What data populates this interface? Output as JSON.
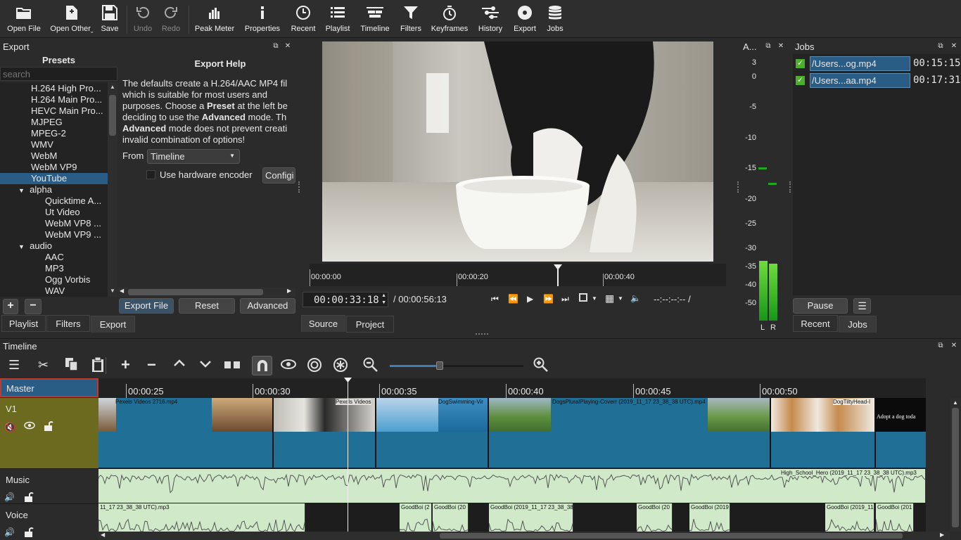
{
  "toolbar": {
    "open_file": "Open File",
    "open_other": "Open Otherˬ",
    "save": "Save",
    "undo": "Undo",
    "redo": "Redo",
    "peak_meter": "Peak Meter",
    "properties": "Properties",
    "recent": "Recent",
    "playlist": "Playlist",
    "timeline": "Timeline",
    "filters": "Filters",
    "keyframes": "Keyframes",
    "history": "History",
    "export": "Export",
    "jobs": "Jobs"
  },
  "export_panel": {
    "title": "Export",
    "presets_label": "Presets",
    "search_placeholder": "search",
    "presets": [
      "H.264 High Pro...",
      "H.264 Main Pro...",
      "HEVC Main Pro...",
      "MJPEG",
      "MPEG-2",
      "WMV",
      "WebM",
      "WebM VP9",
      "YouTube"
    ],
    "group_alpha": "alpha",
    "alpha_items": [
      "Quicktime A...",
      "Ut Video",
      "WebM VP8 ...",
      "WebM VP9 ..."
    ],
    "group_audio": "audio",
    "audio_items": [
      "AAC",
      "MP3",
      "Ogg Vorbis",
      "WAV"
    ],
    "help_title": "Export Help",
    "help_lines": [
      "The defaults create a H.264/AAC MP4 fil",
      "which is suitable for most users and",
      "purposes. Choose a ",
      "Preset",
      " at the left be",
      "deciding to use the ",
      "Advanced",
      " mode. Th",
      "Advanced",
      " mode does not prevent creati",
      "invalid combination of options!"
    ],
    "from_label": "From",
    "from_value": "Timeline",
    "hw_encoder_label": "Use hardware encoder",
    "configure_label": "Configi",
    "export_file_btn": "Export File",
    "reset_btn": "Reset",
    "advanced_btn": "Advanced"
  },
  "left_tabs": {
    "playlist": "Playlist",
    "filters": "Filters",
    "export": "Export"
  },
  "player": {
    "ruler_labels": [
      "00:00:00",
      "00:00:20",
      "00:00:40"
    ],
    "current_time": "00:00:33:18",
    "total_time": "/ 00:00:56:13",
    "in_out": "--:--:--:-- /",
    "source_tab": "Source",
    "project_tab": "Project"
  },
  "audio_meter": {
    "title": "A...",
    "scale": [
      "3",
      "0",
      "-5",
      "-10",
      "-15",
      "-20",
      "-25",
      "-30",
      "-35",
      "-40",
      "-50"
    ],
    "left_label": "L",
    "right_label": "R"
  },
  "jobs_panel": {
    "title": "Jobs",
    "jobs": [
      {
        "name": "/Users...og.mp4",
        "time": "00:15:15"
      },
      {
        "name": "/Users...aa.mp4",
        "time": "00:17:31"
      }
    ],
    "pause_btn": "Pause",
    "recent_tab": "Recent",
    "jobs_tab": "Jobs"
  },
  "timeline": {
    "title": "Timeline",
    "ruler": [
      "00:00:25",
      "00:00:30",
      "00:00:35",
      "00:00:40",
      "00:00:45",
      "00:00:50"
    ],
    "master_label": "Master",
    "tracks": {
      "v1": "V1",
      "music": "Music",
      "voice": "Voice"
    },
    "video_clips": [
      "Pexels Videos 2716.mp4",
      "Pexels Videos",
      "DogSwimming-Vir",
      "DogsPluralPlaying-Coverr (2019_11_17 23_38_38 UTC).mp4",
      "DogTiltyHead-I",
      "Adopt a dog toda"
    ],
    "music_clip": "High_School_Hero (2019_11_17 23_38_38 UTC).mp3",
    "voice_clips": [
      "11_17 23_38_38 UTC).mp3",
      "GoodBoi (2",
      "GoodBoi (20",
      "GoodBoi (2019_11_17 23_38_38",
      "GoodBoi (20",
      "GoodBoi (2019",
      "GoodBoi (2019_11",
      "GoodBoi (201"
    ]
  },
  "colors": {
    "selection": "#2a5d85",
    "v1_track_head": "#6b6a1e",
    "video_clip": "#1f6f96",
    "audio_clip": "#cfe9c9",
    "meter_green": "#1eaa1e"
  }
}
